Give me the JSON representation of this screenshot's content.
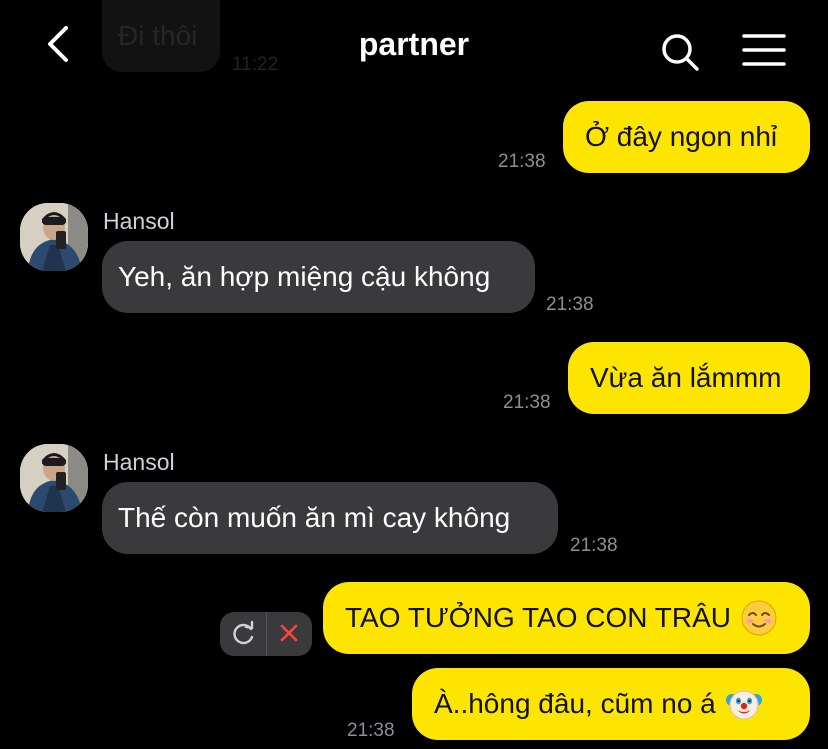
{
  "header": {
    "title": "partner"
  },
  "ghost": {
    "text": "Đi thôi",
    "time": "11:22"
  },
  "messages": [
    {
      "text": "Ở đây ngon nhỉ",
      "time": "21:38"
    },
    {
      "sender": "Hansol",
      "text": "Yeh, ăn hợp miệng cậu không",
      "time": "21:38"
    },
    {
      "text": "Vừa ăn lắmmm",
      "time": "21:38"
    },
    {
      "sender": "Hansol",
      "text": "Thế còn muốn ăn mì cay không",
      "time": "21:38"
    },
    {
      "text": "TAO TƯỞNG TAO CON TRÂU",
      "emoji": "relieved-face-emoji"
    },
    {
      "text": "À..hông đâu, cũm no á",
      "emoji": "clown-face-emoji",
      "time": "21:38"
    }
  ],
  "colors": {
    "outgoing": "#fee500",
    "incoming": "#3a3a3c",
    "background": "#000000",
    "delete": "#ff453a"
  }
}
